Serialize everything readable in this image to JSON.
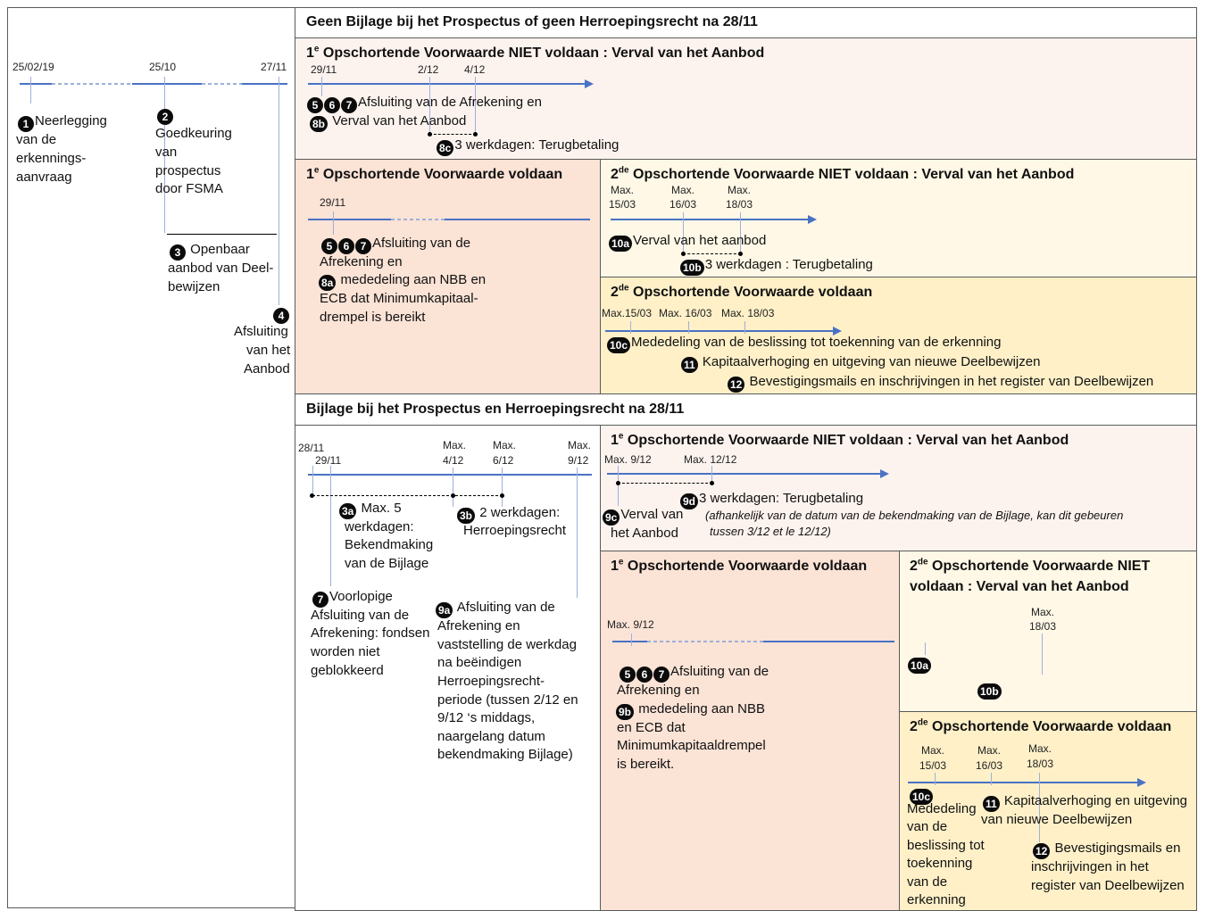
{
  "left": {
    "dates": [
      "25/02/19",
      "25/10",
      "27/11"
    ],
    "step1": {
      "num": "1",
      "lines": [
        "Neerlegging",
        "van de",
        "erkennings-",
        "aanvraag"
      ]
    },
    "step2": {
      "num": "2",
      "lines": [
        "Goedkeuring",
        "van",
        "prospectus",
        "door FSMA"
      ]
    },
    "step3": {
      "num": "3",
      "lines": [
        "Openbaar",
        "aanbod van Deel-",
        "bewijzen"
      ]
    },
    "step4": {
      "num": "4",
      "lines": [
        "Afsluiting",
        "van het",
        "Aanbod"
      ]
    }
  },
  "top": {
    "title": "Geen Bijlage bij het Prospectus of geen Herroepingsrecht na 28/11",
    "c1fail": {
      "title_pre": "1",
      "title_sup": "e",
      "title_post": " Opschortende Voorwaarde NIET voldaan : Verval van het Aanbod",
      "dates": [
        "29/11",
        "2/12",
        "4/12"
      ],
      "nums_a": [
        "5",
        "6",
        "7"
      ],
      "line_a": "Afsluiting van de Afrekening en",
      "num_b": "8b",
      "line_b": "Verval van het Aanbod",
      "num_c": "8c",
      "line_c": "3 werkdagen: Terugbetaling"
    },
    "c1ok": {
      "title_pre": "1",
      "title_sup": "e",
      "title_post": " Opschortende Voorwaarde voldaan",
      "date": "29/11",
      "nums_a": [
        "5",
        "6",
        "7"
      ],
      "lines_a": [
        "Afsluiting van de",
        "Afrekening en"
      ],
      "num_b": "8a",
      "lines_b": [
        "mededeling aan NBB en",
        "ECB dat Minimumkapitaal-",
        "drempel is bereikt"
      ]
    },
    "c2fail": {
      "title_pre": "2",
      "title_sup": "de",
      "title_post": " Opschortende Voorwaarde NIET voldaan : Verval van het Aanbod",
      "dates": [
        [
          "Max.",
          "15/03"
        ],
        [
          "Max.",
          "16/03"
        ],
        [
          "Max.",
          "18/03"
        ]
      ],
      "num_a": "10a",
      "line_a": "Verval van het aanbod",
      "num_b": "10b",
      "line_b": "3 werkdagen : Terugbetaling"
    },
    "c2ok": {
      "title_pre": "2",
      "title_sup": "de",
      "title_post": " Opschortende Voorwaarde voldaan",
      "dates": [
        "Max.15/03",
        "Max. 16/03",
        "Max. 18/03"
      ],
      "num_a": "10c",
      "line_a": "Mededeling van de beslissing tot toekenning van de erkenning",
      "num_b": "11",
      "line_b": "Kapitaalverhoging en uitgeving van nieuwe Deelbewijzen",
      "num_c": "12",
      "line_c": "Bevestigingsmails en inschrijvingen in het register van Deelbewijzen"
    }
  },
  "bottom": {
    "title": "Bijlage bij het Prospectus en Herroepingsrecht na 28/11",
    "timeline": {
      "dates": [
        "28/11",
        "29/11",
        [
          "Max.",
          "4/12"
        ],
        [
          "Max.",
          "6/12"
        ],
        [
          "Max.",
          "9/12"
        ]
      ],
      "num_3a": "3a",
      "lines_3a": [
        "Max. 5",
        "werkdagen:",
        "Bekendmaking",
        "van de Bijlage"
      ],
      "num_3b": "3b",
      "lines_3b": [
        "2 werkdagen:",
        "Herroepingsrecht"
      ],
      "num_7": "7",
      "lines_7": [
        "Voorlopige",
        "Afsluiting van de",
        "Afrekening: fondsen",
        "worden niet",
        "geblokkeerd"
      ],
      "num_9a": "9a",
      "lines_9a": [
        "Afsluiting van de",
        "Afrekening en",
        "vaststelling de werkdag",
        "na beëindigen",
        "Herroepingsrecht-",
        "periode (tussen 2/12 en",
        "9/12 ‘s middags,",
        "naargelang datum",
        "bekendmaking Bijlage)"
      ]
    },
    "c1fail": {
      "title_pre": "1",
      "title_sup": "e",
      "title_post": " Opschortende Voorwaarde NIET voldaan : Verval van het Aanbod",
      "dates": [
        "Max. 9/12",
        "Max. 12/12"
      ],
      "num_9d": "9d",
      "line_9d": "3 werkdagen: Terugbetaling",
      "note": [
        "(afhankelijk van de datum van de bekendmaking van de Bijlage, kan dit gebeuren",
        "tussen 3/12 et le 12/12)"
      ],
      "num_9c": "9c",
      "lines_9c": [
        "Verval van",
        "het Aanbod"
      ]
    },
    "c1ok": {
      "title_pre": "1",
      "title_sup": "e",
      "title_post": " Opschortende Voorwaarde voldaan",
      "date": "Max. 9/12",
      "nums_a": [
        "5",
        "6",
        "7"
      ],
      "lines_a": [
        "Afsluiting van de",
        "Afrekening en"
      ],
      "num_b": "9b",
      "lines_b": [
        "mededeling aan NBB",
        "en ECB dat",
        "Minimumkapitaaldrempel",
        "is bereikt."
      ]
    },
    "c2fail": {
      "title_lines": [
        "NIET",
        "voldaan : Verval van het Aanbod"
      ],
      "title_pre": "2",
      "title_sup": "de",
      "title_post": " Opschortende Voorwaarde",
      "date": [
        "Max.",
        "18/03"
      ],
      "num_a": "10a",
      "num_b": "10b"
    },
    "c2ok": {
      "title_pre": "2",
      "title_sup": "de",
      "title_post": " Opschortende Voorwaarde voldaan",
      "dates": [
        [
          "Max.",
          "15/03"
        ],
        [
          "Max.",
          "16/03"
        ],
        [
          "Max.",
          "18/03"
        ]
      ],
      "num_10c": "10c",
      "lines_10c": [
        "Mededeling",
        "van de",
        "beslissing tot",
        "toekenning",
        "van de",
        "erkenning"
      ],
      "num_11": "11",
      "lines_11": [
        "Kapitaalverhoging en uitgeving",
        "van nieuwe Deelbewijzen"
      ],
      "num_12": "12",
      "lines_12": [
        "Bevestigingsmails en",
        "inschrijvingen in het",
        "register van Deelbewijzen"
      ]
    }
  },
  "colors": {
    "border": "#5a5a5a",
    "peach_light": "#fdf3ee",
    "peach": "#fbe3d6",
    "cream": "#fff8e6",
    "cream_dark": "#fff0c8",
    "timeline": "#4a72c4"
  }
}
